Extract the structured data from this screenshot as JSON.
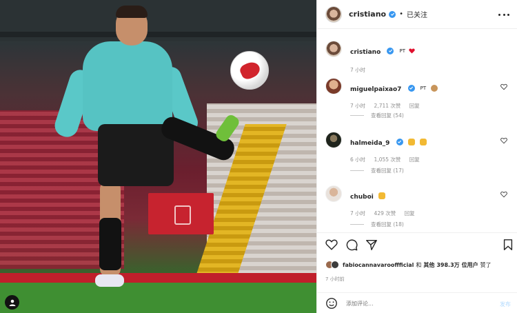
{
  "header": {
    "username": "cristiano",
    "separator": "•",
    "follow_status": "已关注"
  },
  "caption": {
    "username": "cristiano",
    "text": "PT",
    "time": "7 小时"
  },
  "comments": [
    {
      "username": "miguelpaixao7",
      "text": "PT",
      "time": "7 小时",
      "likes": "2,711 次赞",
      "reply": "回复",
      "view_replies": "查看回复 (54)"
    },
    {
      "username": "halmeida_9",
      "text": "",
      "time": "6 小时",
      "likes": "1,055 次赞",
      "reply": "回复",
      "view_replies": "查看回复 (17)"
    },
    {
      "username": "chuboi",
      "text": "",
      "time": "7 小时",
      "likes": "429 次赞",
      "reply": "回复",
      "view_replies": "查看回复 (18)"
    }
  ],
  "likes": {
    "first_user": "fabiocannavarooffficial",
    "connector": "和",
    "others_label": "其他",
    "count": "398.3万",
    "suffix_label": "位用户",
    "liked_label": "赞了"
  },
  "post_time": "7 小时前",
  "add_comment": {
    "placeholder": "添加评论...",
    "post_label": "发布"
  },
  "colors": {
    "verified": "#3897f0",
    "post_disabled": "#b3dbff",
    "heart": "#ed4956"
  },
  "icons": [
    "user-tag-icon",
    "more-icon",
    "verified-icon",
    "heart-icon",
    "comment-icon",
    "share-icon",
    "bookmark-icon",
    "emoji-icon"
  ]
}
